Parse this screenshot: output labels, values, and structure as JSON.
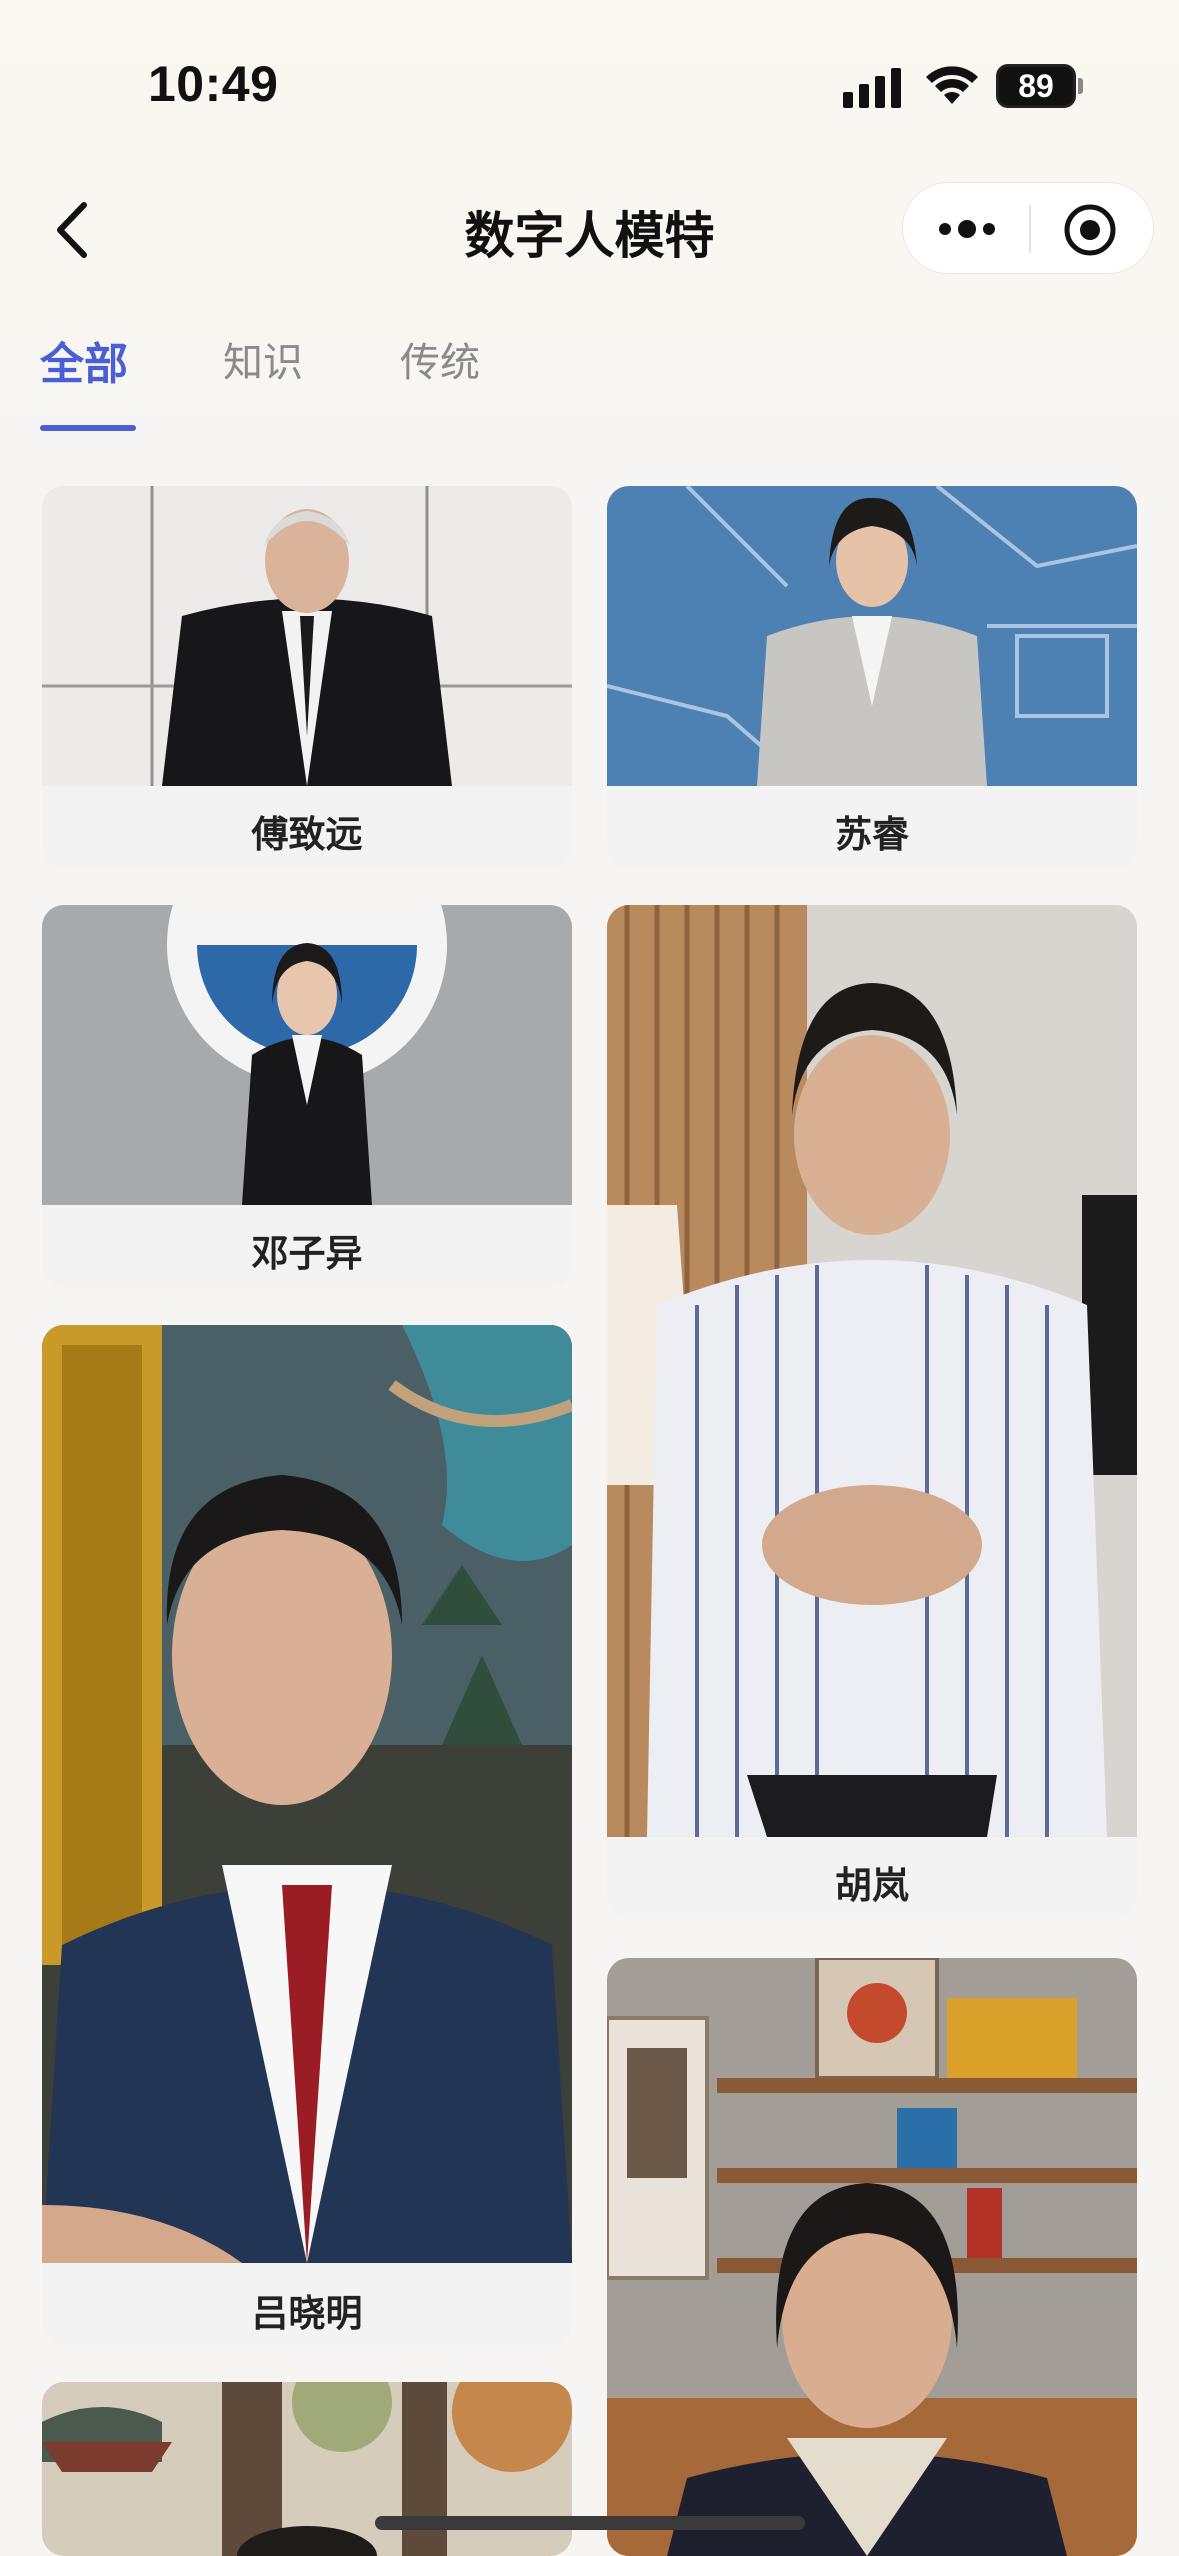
{
  "status_bar": {
    "time": "10:49",
    "battery": "89"
  },
  "nav": {
    "title": "数字人模特"
  },
  "tabs": [
    {
      "label": "全部",
      "active": true
    },
    {
      "label": "知识",
      "active": false
    },
    {
      "label": "传统",
      "active": false
    }
  ],
  "models": [
    {
      "name": "傅致远"
    },
    {
      "name": "苏睿"
    },
    {
      "name": "邓子异"
    },
    {
      "name": "胡岚"
    },
    {
      "name": "吕晓明"
    },
    {
      "name": ""
    },
    {
      "name": ""
    }
  ],
  "colors": {
    "accent": "#4a5fd6",
    "background": "#f6f5f4"
  }
}
